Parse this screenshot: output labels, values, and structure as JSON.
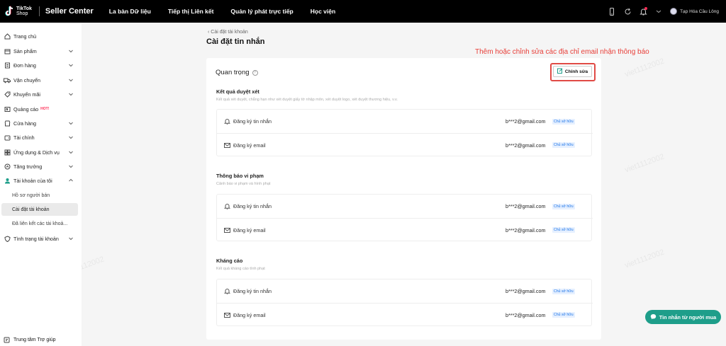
{
  "topbar": {
    "logo_text_line1": "TikTok",
    "logo_text_line2": "Shop",
    "app_title": "Seller Center",
    "nav": [
      "La bàn Dữ liệu",
      "Tiếp thị Liên kết",
      "Quản lý phát trực tiếp",
      "Học viện"
    ],
    "shop_name": "Tạp Hóa Cầu Lông",
    "icons": [
      "phone-icon",
      "refresh-icon",
      "bell-icon",
      "chevron-icon"
    ]
  },
  "sidebar": {
    "items": [
      {
        "label": "Trang chủ",
        "icon": "home-icon",
        "chevron": false
      },
      {
        "label": "Sản phẩm",
        "icon": "box-icon",
        "chevron": true
      },
      {
        "label": "Đơn hàng",
        "icon": "order-icon",
        "chevron": true
      },
      {
        "label": "Vận chuyển",
        "icon": "truck-icon",
        "chevron": true
      },
      {
        "label": "Khuyến mãi",
        "icon": "promo-icon",
        "chevron": true
      },
      {
        "label": "Quảng cáo",
        "icon": "ads-icon",
        "chevron": false,
        "badge": "HOT!"
      },
      {
        "label": "Cửa hàng",
        "icon": "store-icon",
        "chevron": true
      },
      {
        "label": "Tài chính",
        "icon": "wallet-icon",
        "chevron": true
      },
      {
        "label": "Ứng dụng & Dịch vụ",
        "icon": "apps-icon",
        "chevron": true
      },
      {
        "label": "Tăng trưởng",
        "icon": "growth-icon",
        "chevron": true
      },
      {
        "label": "Tài khoản của tôi",
        "icon": "user-icon",
        "chevron": true
      }
    ],
    "subitems": [
      "Hồ sơ người bán",
      "Cài đặt tài khoản",
      "Đã liên kết các tài khoả..."
    ],
    "after": {
      "label": "Tình trạng tài khoản",
      "icon": "shield-icon"
    },
    "help": "Trung tâm Trợ giúp"
  },
  "page": {
    "breadcrumb": "Cài đặt tài khoản",
    "title": "Cài đặt tin nhắn",
    "annotation": "Thêm hoặc chỉnh sửa các địa chỉ email nhận thông báo",
    "section_title": "Quan trọng",
    "edit_label": "Chỉnh sửa",
    "groups": [
      {
        "title": "Kết quả duyệt xét",
        "desc": "Kết quả xét duyệt, chẳng hạn như xét duyệt giấy tờ nhập môn, xét duyệt logo, xét duyệt thương hiệu, v.v.",
        "rows": [
          {
            "label": "Đăng ký tin nhắn",
            "email": "b***2@gmail.com",
            "badge": "Chủ sở hữu"
          },
          {
            "label": "Đăng ký email",
            "email": "b***2@gmail.com",
            "badge": "Chủ sở hữu"
          }
        ]
      },
      {
        "title": "Thông báo vi phạm",
        "desc": "Cảnh báo vi phạm và hình phạt",
        "rows": [
          {
            "label": "Đăng ký tin nhắn",
            "email": "b***2@gmail.com",
            "badge": "Chủ sở hữu"
          },
          {
            "label": "Đăng ký email",
            "email": "b***2@gmail.com",
            "badge": "Chủ sở hữu"
          }
        ]
      },
      {
        "title": "Kháng cáo",
        "desc": "Kết quả kháng cáo tình phạt",
        "rows": [
          {
            "label": "Đăng ký tin nhắn",
            "email": "b***2@gmail.com",
            "badge": "Chủ sở hữu"
          },
          {
            "label": "Đăng ký email",
            "email": "b***2@gmail.com",
            "badge": "Chủ sở hữu"
          }
        ]
      }
    ]
  },
  "chat_button": "Tin nhắn từ người mua",
  "watermark": "viet1112002",
  "colors": {
    "brand_teal": "#1e9e8a",
    "annotation_red": "#e8403a",
    "badge_blue": "#1a73e8",
    "topbar": "#000000"
  }
}
